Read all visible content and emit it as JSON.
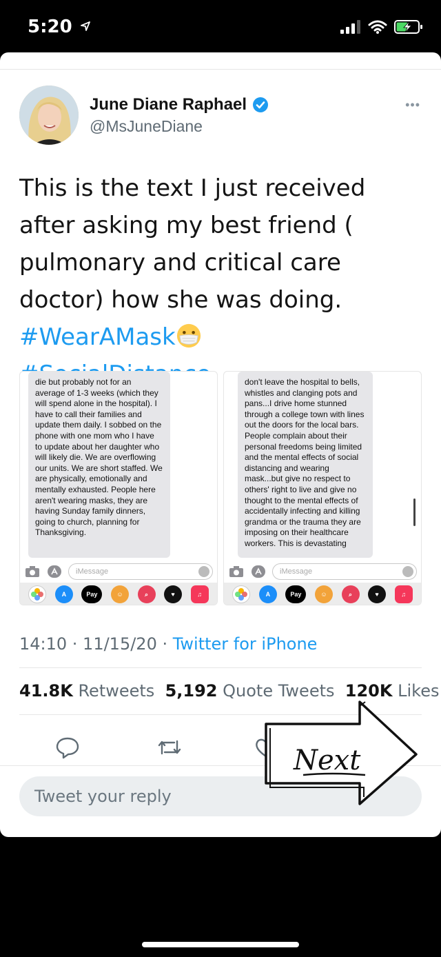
{
  "status_bar": {
    "time": "5:20"
  },
  "tweet": {
    "author_name": "June Diane Raphael",
    "handle": "@MsJuneDiane",
    "text": "This is the text I just received after asking my best friend ( pulmonary and critical care doctor) how she was doing.",
    "hashtags": [
      "#WearAMask",
      "#SocialDistance"
    ],
    "timestamp": "14:10 · 11/15/20 · ",
    "source": "Twitter for iPhone"
  },
  "screenshots": {
    "left_text": "die but probably not for an average of 1-3 weeks (which they will spend alone in the hospital). I have to call their families and update them daily. I sobbed on the phone with one mom who I have to update about her daughter who will likely die. We are overflowing our units. We are short staffed. We are physically, emotionally and mentally exhausted. People here aren't wearing masks, they are having Sunday family dinners, going to church, planning for Thanksgiving.",
    "right_text": "don't leave the hospital to bells, whistles and clanging pots and pans...I drive home stunned through a college town with lines out the doors for the local bars. People complain about their personal freedoms being limited and the mental effects of social distancing and wearing mask...but give no respect to others' right to live and give no thought to the mental effects of accidentally infecting and killing grandma or the trauma they are imposing on their healthcare workers. This is devastating",
    "imessage_placeholder": "iMessage",
    "apple_pay": "Pay"
  },
  "stats": {
    "retweets_count": "41.8K",
    "retweets_label": "Retweets",
    "quotes_count": "5,192",
    "quotes_label": "Quote Tweets",
    "likes_count": "120K",
    "likes_label": "Likes"
  },
  "reply": {
    "placeholder": "Tweet your reply"
  },
  "overlay": {
    "next_label": "Next"
  },
  "colors": {
    "accent": "#1d9bf0",
    "verified": "#1d9bf0",
    "text": "#141414",
    "muted": "#5f6b74"
  }
}
